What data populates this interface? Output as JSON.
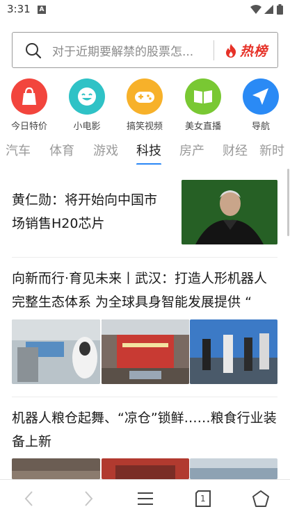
{
  "status_bar": {
    "time": "3:31",
    "notification_icon": "A"
  },
  "search": {
    "placeholder": "对于近期要解禁的股票怎...",
    "hot_label": "热榜",
    "search_icon": "search-icon",
    "hot_icon": "flame-icon"
  },
  "shortcuts": [
    {
      "label": "今日特价",
      "icon": "shopping-bag-icon",
      "color": "#f2453d"
    },
    {
      "label": "小电影",
      "icon": "smiley-icon",
      "color": "#2fc2c6"
    },
    {
      "label": "搞笑视频",
      "icon": "gamepad-icon",
      "color": "#f7b12a"
    },
    {
      "label": "美女直播",
      "icon": "book-icon",
      "color": "#79c833"
    },
    {
      "label": "导航",
      "icon": "send-icon",
      "color": "#2a8af5"
    }
  ],
  "tabs": [
    {
      "label": "汽车",
      "active": false
    },
    {
      "label": "体育",
      "active": false
    },
    {
      "label": "游戏",
      "active": false
    },
    {
      "label": "科技",
      "active": true
    },
    {
      "label": "房产",
      "active": false
    },
    {
      "label": "财经",
      "active": false
    },
    {
      "label": "新时",
      "active": false
    }
  ],
  "articles": [
    {
      "title": "黄仁勋：将开始向中国市场销售H20芯片"
    },
    {
      "title": "向新而行·育见未来丨武汉：打造人形机器人完整生态体系 为全球具身智能发展提供 “"
    },
    {
      "title": "机器人粮仓起舞、“凉仓”锁鲜……粮食行业装备上新"
    }
  ],
  "bottom_nav": {
    "back_icon": "back-icon",
    "forward_icon": "forward-icon",
    "menu_icon": "menu-icon",
    "tabs_count": "1",
    "home_icon": "home-icon"
  },
  "colors": {
    "accent_blue": "#2a87f5",
    "hot_red": "#e63228"
  }
}
